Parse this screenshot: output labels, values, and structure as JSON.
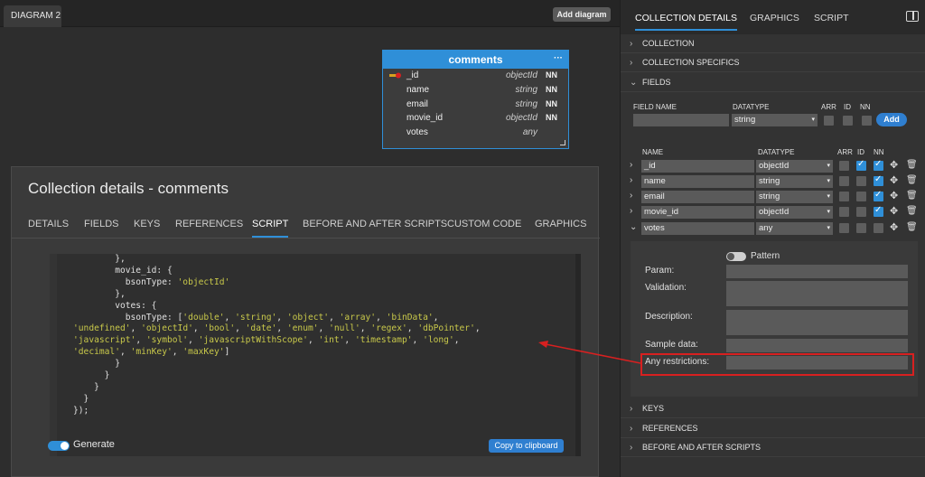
{
  "diagram": {
    "tab_label": "DIAGRAM 2",
    "add_button": "Add diagram",
    "collection": {
      "name": "comments",
      "menu": "···",
      "fields": [
        {
          "name": "_id",
          "type": "objectId",
          "nn": "NN"
        },
        {
          "name": "name",
          "type": "string",
          "nn": "NN"
        },
        {
          "name": "email",
          "type": "string",
          "nn": "NN"
        },
        {
          "name": "movie_id",
          "type": "objectId",
          "nn": "NN"
        },
        {
          "name": "votes",
          "type": "any",
          "nn": ""
        }
      ]
    }
  },
  "modal": {
    "title": "Collection details - comments",
    "tabs": [
      "DETAILS",
      "FIELDS",
      "KEYS",
      "REFERENCES",
      "SCRIPT",
      "BEFORE AND AFTER SCRIPTS",
      "CUSTOM CODE",
      "GRAPHICS"
    ],
    "active_tab": "SCRIPT",
    "code_lines": [
      "        },",
      "        movie_id: {",
      "          bsonType: 'objectId'",
      "        },",
      "        votes: {",
      "          bsonType: ['double', 'string', 'object', 'array', 'binData',",
      "'undefined', 'objectId', 'bool', 'date', 'enum', 'null', 'regex', 'dbPointer',",
      "'javascript', 'symbol', 'javascriptWithScope', 'int', 'timestamp', 'long',",
      "'decimal', 'minKey', 'maxKey']",
      "        }",
      "      }",
      "    }",
      "  }",
      "});"
    ],
    "generate_label": "Generate",
    "copy_button": "Copy to clipboard"
  },
  "panel": {
    "tabs": [
      "COLLECTION DETAILS",
      "GRAPHICS",
      "SCRIPT"
    ],
    "active_tab": "COLLECTION DETAILS",
    "sections_top": [
      "COLLECTION",
      "COLLECTION SPECIFICS",
      "FIELDS"
    ],
    "new_field": {
      "headers": {
        "name": "FIELD NAME",
        "datatype": "DATATYPE",
        "arr": "ARR",
        "id": "ID",
        "nn": "NN"
      },
      "datatype_value": "string",
      "add_button": "Add"
    },
    "list_headers": {
      "name": "NAME",
      "datatype": "DATATYPE",
      "arr": "ARR",
      "id": "ID",
      "nn": "NN"
    },
    "rows": [
      {
        "name": "_id",
        "datatype": "objectId",
        "arr": false,
        "id": true,
        "nn": true
      },
      {
        "name": "name",
        "datatype": "string",
        "arr": false,
        "id": false,
        "nn": true
      },
      {
        "name": "email",
        "datatype": "string",
        "arr": false,
        "id": false,
        "nn": true
      },
      {
        "name": "movie_id",
        "datatype": "objectId",
        "arr": false,
        "id": false,
        "nn": true
      },
      {
        "name": "votes",
        "datatype": "any",
        "arr": false,
        "id": false,
        "nn": false
      }
    ],
    "detail": {
      "pattern_label": "Pattern",
      "param_label": "Param:",
      "validation_label": "Validation:",
      "description_label": "Description:",
      "sample_label": "Sample data:",
      "restrictions_label": "Any restrictions:"
    },
    "sections_bottom": [
      "KEYS",
      "REFERENCES",
      "BEFORE AND AFTER SCRIPTS"
    ]
  },
  "colors": {
    "accent": "#2f8fd8",
    "highlight": "#d82020",
    "code_string": "#c8c84a"
  },
  "icons": {
    "chevron": "chevron-right-icon",
    "move": "move-icon",
    "trash": "trash-icon",
    "key": "key-icon",
    "panel_layout": "panel-layout-icon"
  }
}
